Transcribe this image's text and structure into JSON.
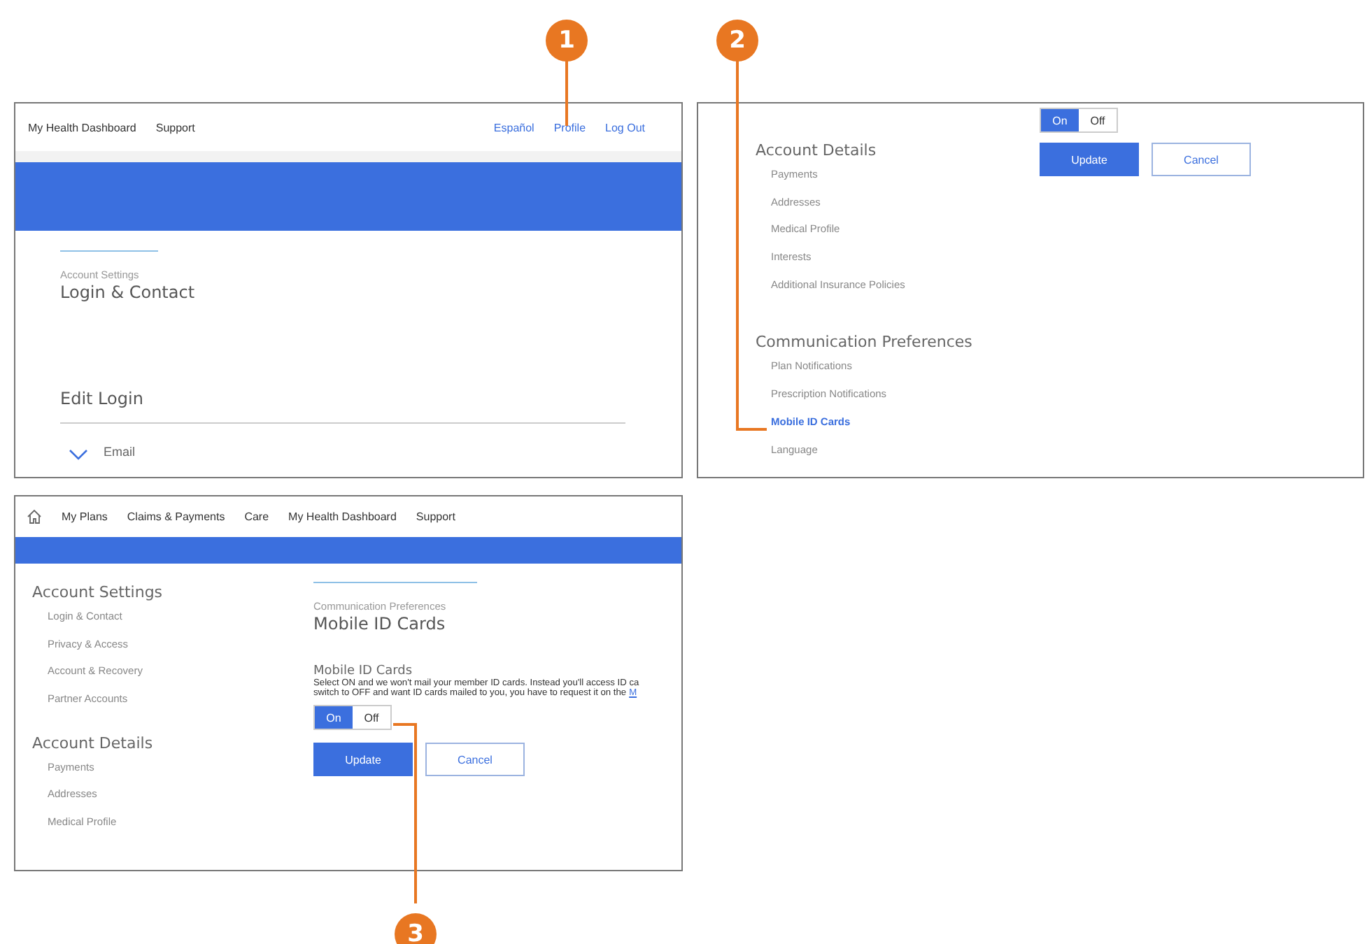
{
  "callouts": [
    {
      "number": "1"
    },
    {
      "number": "2"
    },
    {
      "number": "3"
    }
  ],
  "screen_1": {
    "nav_links": [
      "My Health Dashboard",
      "Support"
    ],
    "header_links": [
      "Español",
      "Profile",
      "Log Out"
    ],
    "breadcrumb": "Account Settings",
    "title": "Login & Contact",
    "section_title": "Edit Login",
    "rows": [
      {
        "label": "Email"
      }
    ]
  },
  "screen_2": {
    "toggle": [
      {
        "label": "On",
        "selected": true
      },
      {
        "label": "Off",
        "selected": false
      }
    ],
    "buttons": [
      {
        "label": "Update",
        "kind": "primary"
      },
      {
        "label": "Cancel",
        "kind": "secondary"
      }
    ],
    "groups": [
      {
        "heading": "Account Details",
        "items": [
          {
            "label": "Payments",
            "selected": false
          },
          {
            "label": "Addresses",
            "selected": false
          },
          {
            "label": "Medical Profile",
            "selected": false
          },
          {
            "label": "Interests",
            "selected": false
          },
          {
            "label": "Additional Insurance Policies",
            "selected": false
          }
        ]
      },
      {
        "heading": "Communication Preferences",
        "items": [
          {
            "label": "Plan Notifications",
            "selected": false
          },
          {
            "label": "Prescription Notifications",
            "selected": false
          },
          {
            "label": "Mobile ID Cards",
            "selected": true
          },
          {
            "label": "Language",
            "selected": false
          }
        ]
      }
    ]
  },
  "screen_3": {
    "nav_links": [
      "My Plans",
      "Claims & Payments",
      "Care",
      "My Health Dashboard",
      "Support"
    ],
    "groups": [
      {
        "heading": "Account Settings",
        "items": [
          "Login & Contact",
          "Privacy & Access",
          "Account & Recovery",
          "Partner Accounts"
        ]
      },
      {
        "heading": "Account Details",
        "items": [
          "Payments",
          "Addresses",
          "Medical Profile"
        ]
      }
    ],
    "breadcrumb": "Communication Preferences",
    "title": "Mobile ID Cards",
    "setting_label": "Mobile ID Cards",
    "description_lines": [
      "Select ON and we won't mail your member ID cards. Instead you'll access ID ca",
      "switch to OFF and want ID cards mailed to you, you have to request it on the"
    ],
    "description_link": "M",
    "toggle": [
      {
        "label": "On",
        "selected": true
      },
      {
        "label": "Off",
        "selected": false
      }
    ],
    "buttons": [
      {
        "label": "Update",
        "kind": "primary"
      },
      {
        "label": "Cancel",
        "kind": "secondary"
      }
    ]
  }
}
